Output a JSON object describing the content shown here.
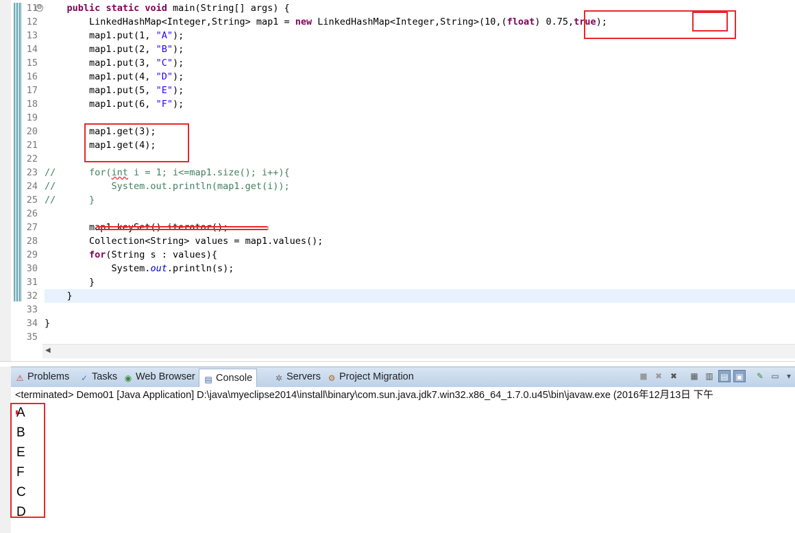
{
  "editor": {
    "fold_icon": "⊖",
    "lines": [
      {
        "num": "11",
        "segments": [
          {
            "t": "    "
          },
          {
            "t": "public",
            "c": "kw"
          },
          {
            "t": " "
          },
          {
            "t": "static",
            "c": "kw"
          },
          {
            "t": " "
          },
          {
            "t": "void",
            "c": "kw"
          },
          {
            "t": " main(String[] args) {"
          }
        ]
      },
      {
        "num": "12",
        "segments": [
          {
            "t": "        LinkedHashMap<Integer,String> map1 = "
          },
          {
            "t": "new",
            "c": "kw"
          },
          {
            "t": " LinkedHashMap<Integer,String>(10,("
          },
          {
            "t": "float",
            "c": "kw"
          },
          {
            "t": ") 0.75,"
          },
          {
            "t": "true",
            "c": "kw"
          },
          {
            "t": ");"
          }
        ]
      },
      {
        "num": "13",
        "segments": [
          {
            "t": "        map1.put(1, "
          },
          {
            "t": "\"A\"",
            "c": "str"
          },
          {
            "t": ");"
          }
        ]
      },
      {
        "num": "14",
        "segments": [
          {
            "t": "        map1.put(2, "
          },
          {
            "t": "\"B\"",
            "c": "str"
          },
          {
            "t": ");"
          }
        ]
      },
      {
        "num": "15",
        "segments": [
          {
            "t": "        map1.put(3, "
          },
          {
            "t": "\"C\"",
            "c": "str"
          },
          {
            "t": ");"
          }
        ]
      },
      {
        "num": "16",
        "segments": [
          {
            "t": "        map1.put(4, "
          },
          {
            "t": "\"D\"",
            "c": "str"
          },
          {
            "t": ");"
          }
        ]
      },
      {
        "num": "17",
        "segments": [
          {
            "t": "        map1.put(5, "
          },
          {
            "t": "\"E\"",
            "c": "str"
          },
          {
            "t": ");"
          }
        ]
      },
      {
        "num": "18",
        "segments": [
          {
            "t": "        map1.put(6, "
          },
          {
            "t": "\"F\"",
            "c": "str"
          },
          {
            "t": ");"
          }
        ]
      },
      {
        "num": "19",
        "segments": []
      },
      {
        "num": "20",
        "segments": [
          {
            "t": "        map1.get(3);"
          }
        ]
      },
      {
        "num": "21",
        "segments": [
          {
            "t": "        map1.get(4);"
          }
        ]
      },
      {
        "num": "22",
        "segments": []
      },
      {
        "num": "23",
        "segments": [
          {
            "t": "//      for(",
            "c": "cmt"
          },
          {
            "t": "int",
            "c": "cmt squig"
          },
          {
            "t": " i = 1; i<=map1.size(); i++){",
            "c": "cmt"
          }
        ]
      },
      {
        "num": "24",
        "segments": [
          {
            "t": "//          System.out.println(map1.get(i));",
            "c": "cmt"
          }
        ]
      },
      {
        "num": "25",
        "segments": [
          {
            "t": "//      }",
            "c": "cmt"
          }
        ]
      },
      {
        "num": "26",
        "segments": []
      },
      {
        "num": "27",
        "segments": [
          {
            "t": "        map1.keySet().iterator();"
          }
        ]
      },
      {
        "num": "28",
        "segments": [
          {
            "t": "        Collection<String> values = map1.values();"
          }
        ]
      },
      {
        "num": "29",
        "segments": [
          {
            "t": "        "
          },
          {
            "t": "for",
            "c": "kw"
          },
          {
            "t": "(String s : values){"
          }
        ]
      },
      {
        "num": "30",
        "segments": [
          {
            "t": "            System."
          },
          {
            "t": "out",
            "c": "fld"
          },
          {
            "t": ".println(s);"
          }
        ]
      },
      {
        "num": "31",
        "segments": [
          {
            "t": "        }"
          }
        ]
      },
      {
        "num": "32",
        "segments": [
          {
            "t": "    }"
          }
        ]
      },
      {
        "num": "33",
        "segments": []
      },
      {
        "num": "34",
        "segments": [
          {
            "t": "}"
          }
        ]
      },
      {
        "num": "35",
        "segments": []
      }
    ],
    "hscroll_left_arrow": "◀"
  },
  "console": {
    "tabs": [
      {
        "label": "Problems",
        "icon": "problems-icon",
        "glyph": "⚠"
      },
      {
        "label": "Tasks",
        "icon": "tasks-icon",
        "glyph": "✓"
      },
      {
        "label": "Web Browser",
        "icon": "web-browser-icon",
        "glyph": "◉"
      },
      {
        "label": "Console",
        "icon": "console-icon",
        "glyph": "▤"
      },
      {
        "label": "Servers",
        "icon": "servers-icon",
        "glyph": "✲"
      },
      {
        "label": "Project Migration",
        "icon": "project-migration-icon",
        "glyph": "⚙"
      }
    ],
    "active_tab": "Console",
    "toolbar": [
      {
        "name": "terminate-icon",
        "glyph": "■"
      },
      {
        "name": "remove-launch-icon",
        "glyph": "✖"
      },
      {
        "name": "remove-all-terminated-icon",
        "glyph": "✖"
      },
      {
        "name": "clear-console-icon",
        "glyph": "▦"
      },
      {
        "name": "scroll-lock-icon",
        "glyph": "▥"
      },
      {
        "name": "show-on-stdout-icon",
        "glyph": "▤"
      },
      {
        "name": "show-on-stderr-icon",
        "glyph": "▣"
      },
      {
        "name": "pin-console-icon",
        "glyph": "✎"
      },
      {
        "name": "display-console-icon",
        "glyph": "▭"
      },
      {
        "name": "view-menu-icon",
        "glyph": "▾"
      }
    ],
    "terminated_text": "<terminated> Demo01 [Java Application] D:\\java\\myeclipse2014\\install\\binary\\com.sun.java.jdk7.win32.x86_64_1.7.0.u45\\bin\\javaw.exe (2016年12月13日 下午",
    "output": [
      "A",
      "B",
      "E",
      "F",
      "C",
      "D"
    ]
  },
  "colors": {
    "annotation_red": "#e8262b",
    "keyword": "#7f0055",
    "string": "#2a00ff",
    "comment": "#3f7f5f",
    "current_line": "#e8f2fe"
  }
}
